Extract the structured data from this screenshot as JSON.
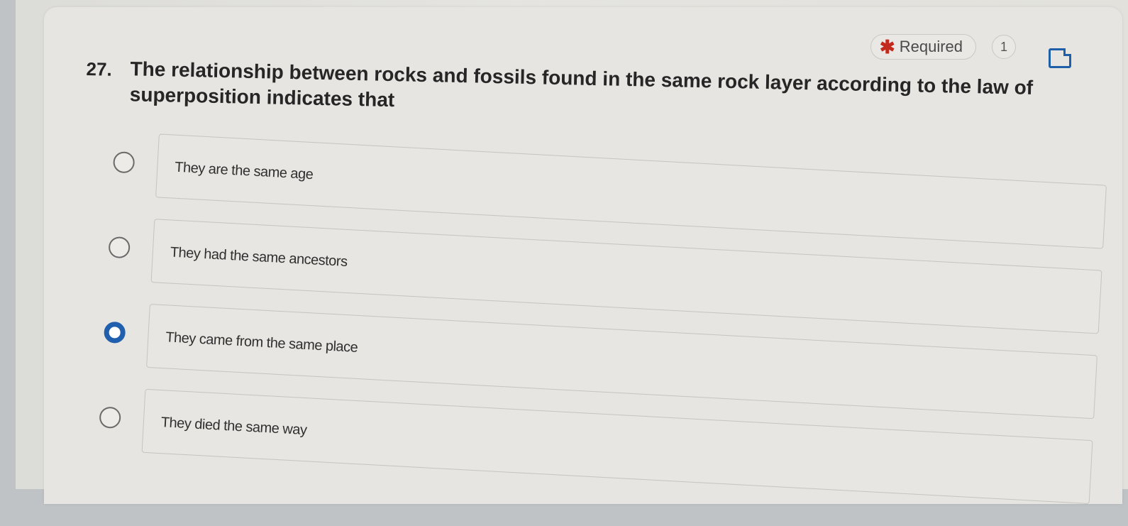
{
  "header": {
    "required_label": "Required",
    "required_icon": "asterisk-icon",
    "points": "1",
    "bookmark_icon": "bookmark-icon"
  },
  "question": {
    "number": "27.",
    "text": "The relationship between rocks and fossils found in the same rock layer according to the law of superposition indicates that"
  },
  "options": [
    {
      "label": "They are the same age",
      "selected": false
    },
    {
      "label": "They had the same ancestors",
      "selected": false
    },
    {
      "label": "They came from the same place",
      "selected": true
    },
    {
      "label": "They died the same way",
      "selected": false
    }
  ],
  "colors": {
    "accent": "#1f5fae",
    "required_star": "#c32a1e"
  }
}
